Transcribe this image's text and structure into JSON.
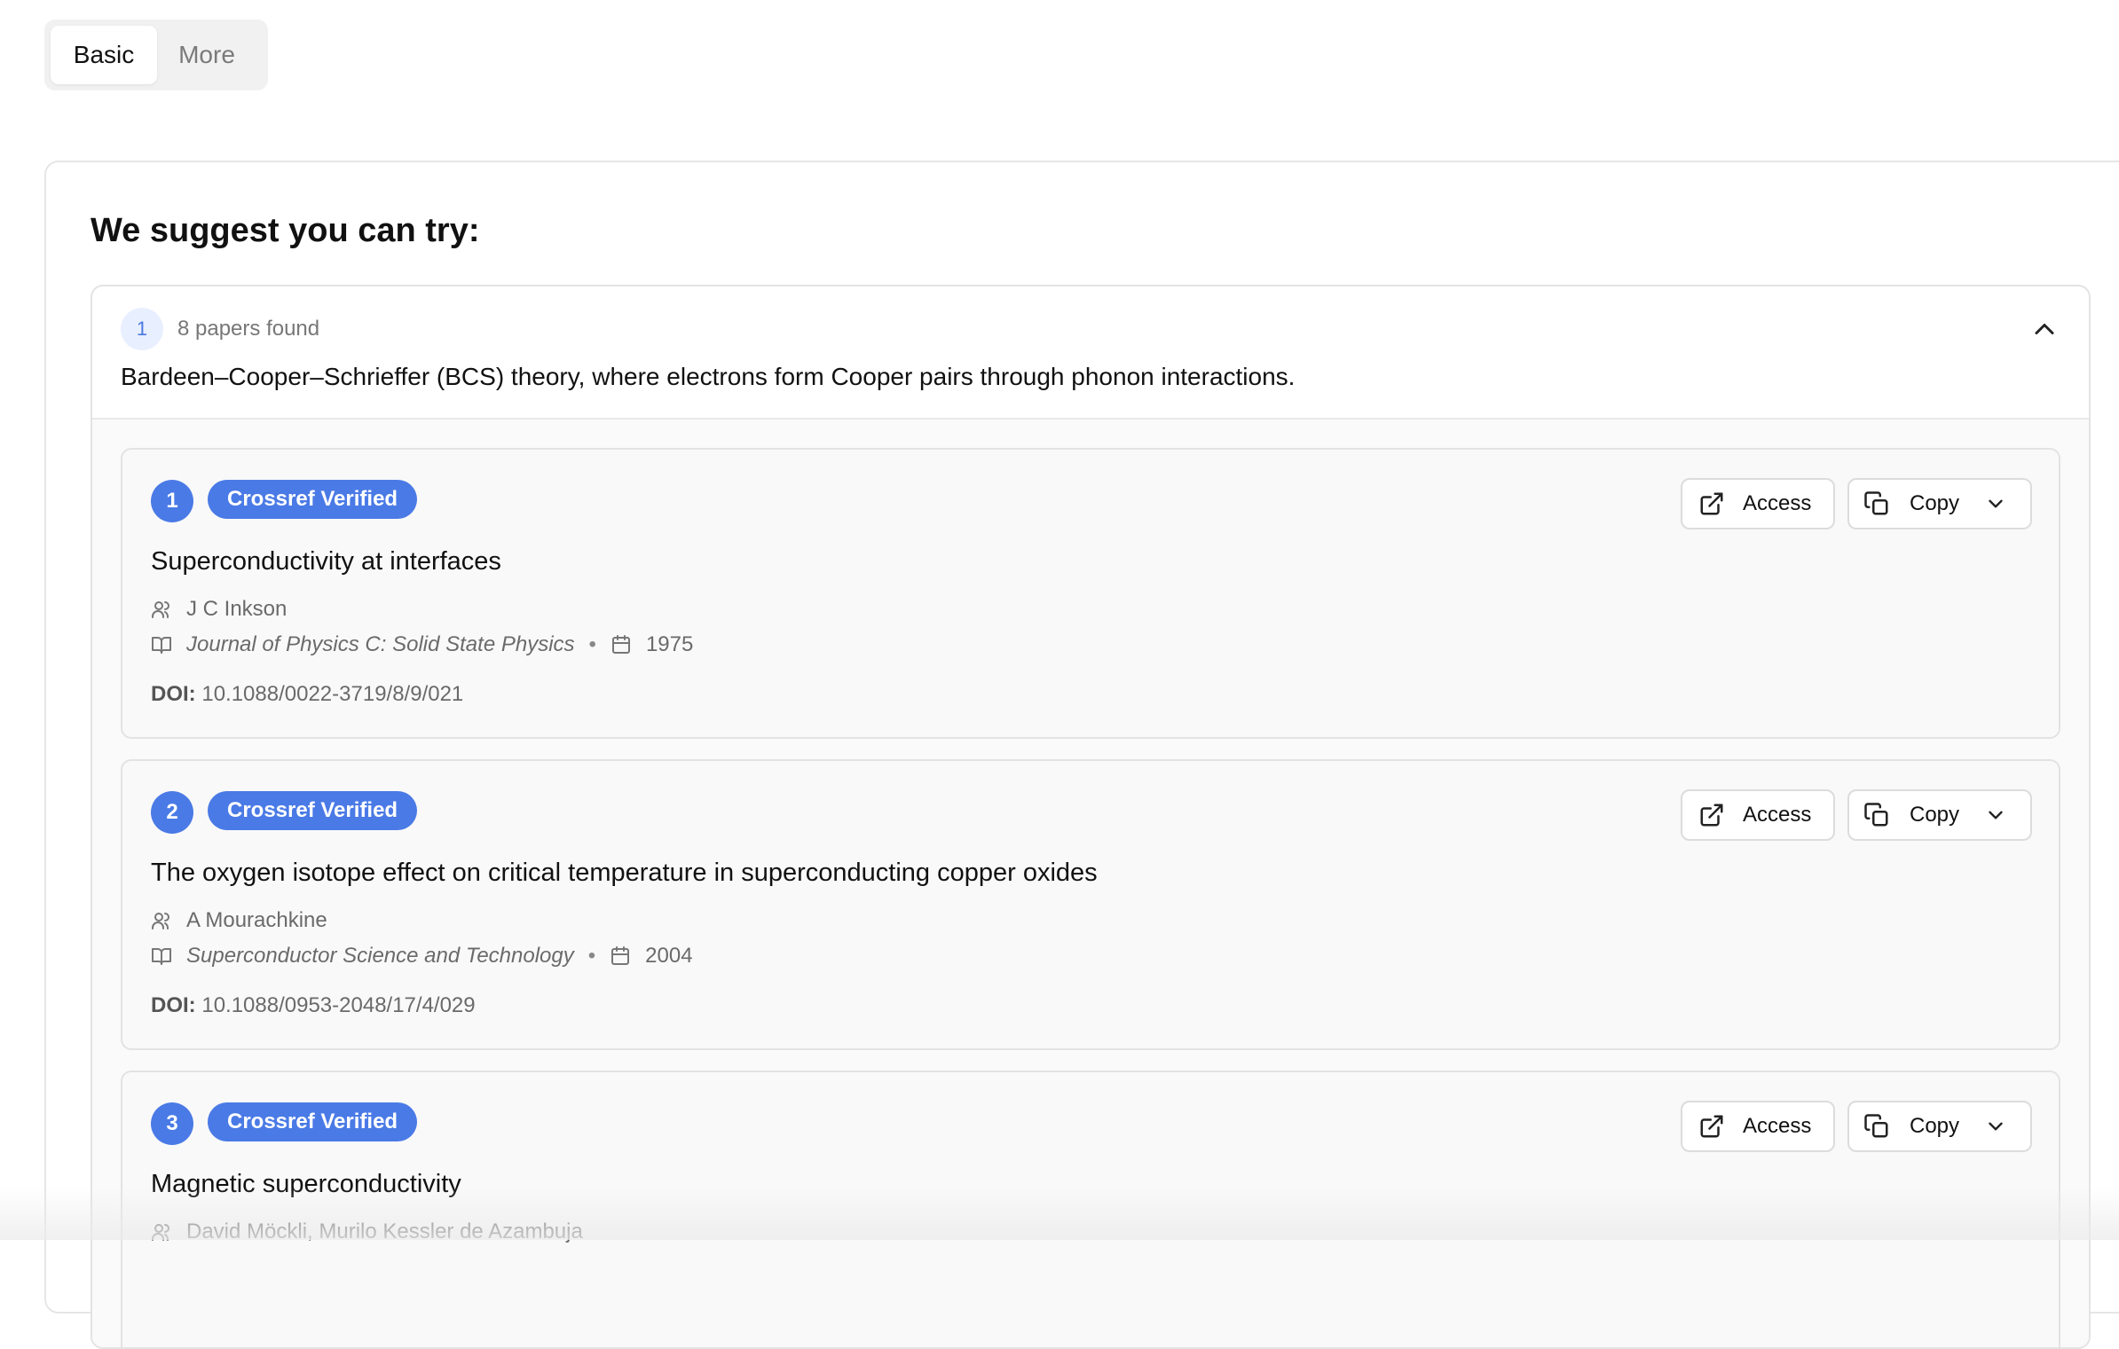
{
  "tabs": [
    {
      "label": "Basic"
    },
    {
      "label": "More"
    }
  ],
  "main": {
    "heading": "We suggest you can try:"
  },
  "suggestion": {
    "number": "1",
    "count_text": "8 papers found",
    "text": "Bardeen–Cooper–Schrieffer (BCS) theory, where electrons form Cooper pairs through phonon interactions."
  },
  "papers": [
    {
      "number": "1",
      "badge": "Crossref Verified",
      "title": "Superconductivity at interfaces",
      "authors": "J C Inkson",
      "journal": "Journal of Physics C: Solid State Physics",
      "year": "1975",
      "doi_label": "DOI:",
      "doi": "10.1088/0022-3719/8/9/021",
      "access_label": "Access",
      "copy_label": "Copy"
    },
    {
      "number": "2",
      "badge": "Crossref Verified",
      "title": "The oxygen isotope effect on critical temperature in superconducting copper oxides",
      "authors": "A Mourachkine",
      "journal": "Superconductor Science and Technology",
      "year": "2004",
      "doi_label": "DOI:",
      "doi": "10.1088/0953-2048/17/4/029",
      "access_label": "Access",
      "copy_label": "Copy"
    },
    {
      "number": "3",
      "badge": "Crossref Verified",
      "title": "Magnetic superconductivity",
      "authors": "David Möckli, Murilo Kessler de Azambuja",
      "access_label": "Access",
      "copy_label": "Copy"
    }
  ],
  "colors": {
    "accent": "#4a7ae6",
    "badge_bg_light": "#e8efff"
  },
  "icons": [
    "chevron-up-icon",
    "external-link-icon",
    "copy-icon",
    "chevron-down-icon",
    "users-icon",
    "book-icon",
    "calendar-icon"
  ]
}
